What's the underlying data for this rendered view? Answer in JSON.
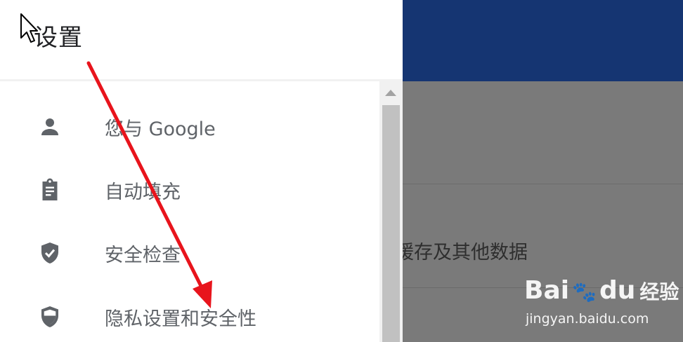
{
  "drawer": {
    "title": "设置",
    "items": [
      {
        "label": "您与 Google",
        "icon": "person-icon"
      },
      {
        "label": "自动填充",
        "icon": "clipboard-icon"
      },
      {
        "label": "安全检查",
        "icon": "shield-check-icon"
      },
      {
        "label": "隐私设置和安全性",
        "icon": "shield-half-icon"
      }
    ]
  },
  "background": {
    "row_text": "缓存及其他数据"
  },
  "watermark": {
    "brand_left": "Bai",
    "brand_mid": "du",
    "brand_right": "经验",
    "url": "jingyan.baidu.com"
  },
  "colors": {
    "header_blue": "#153572",
    "annotation_red": "#e8141c",
    "icon_gray": "#5f6368"
  }
}
